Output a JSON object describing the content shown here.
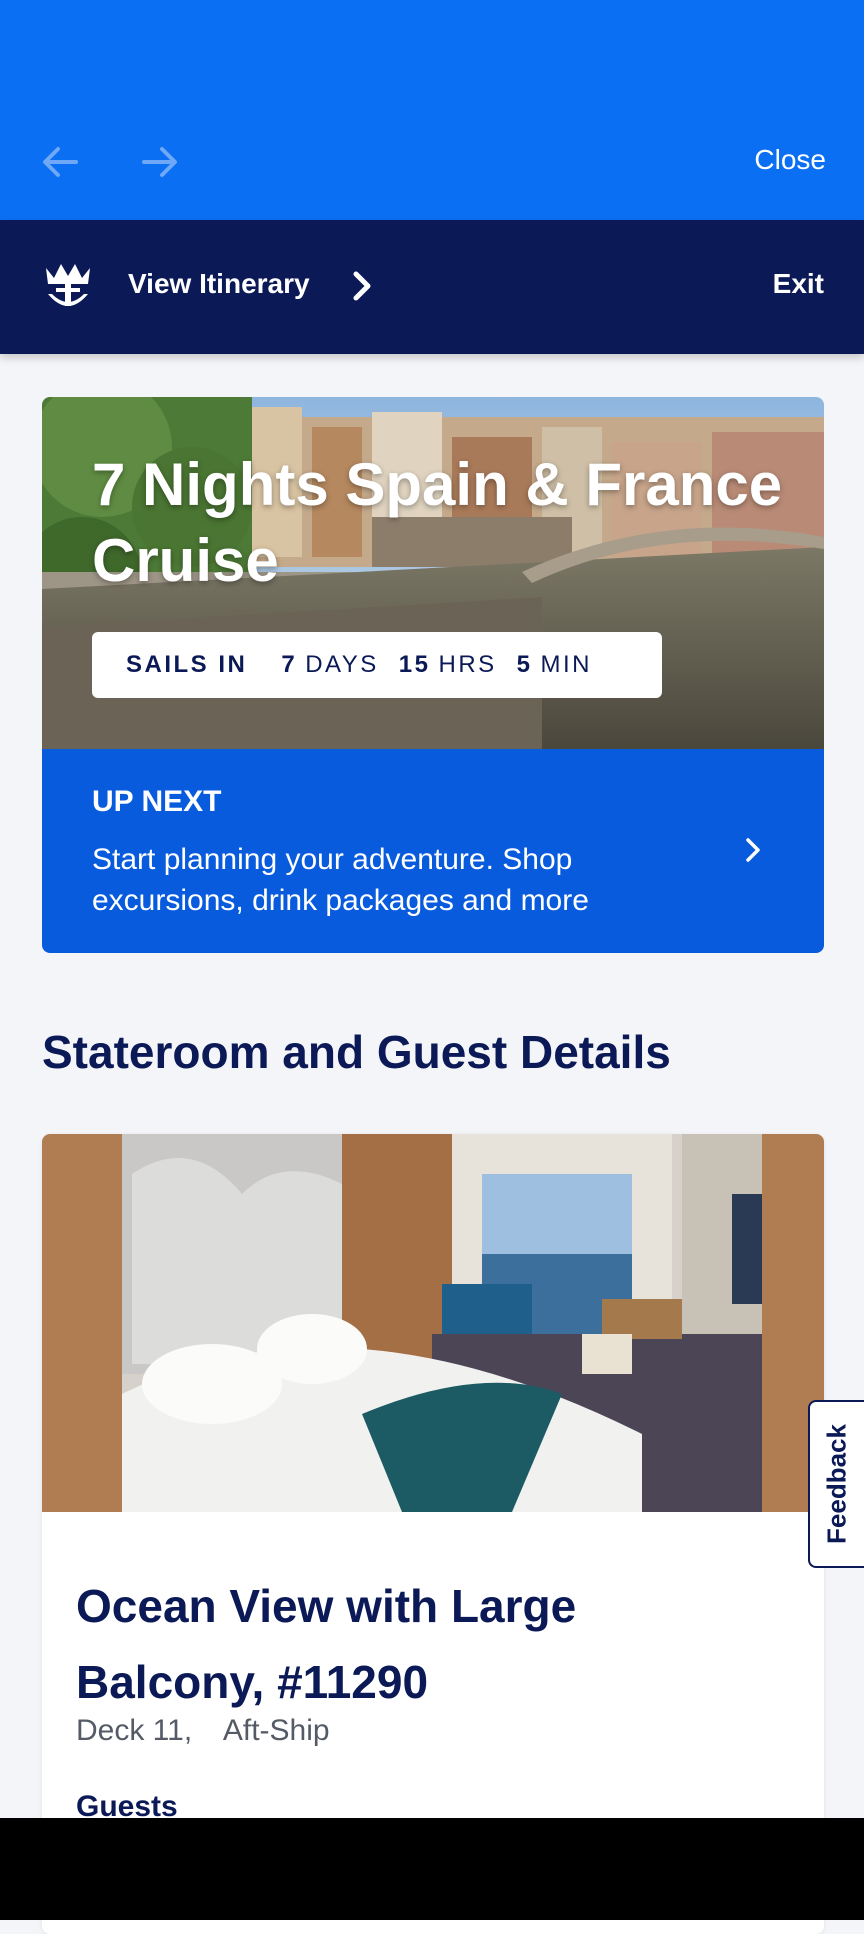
{
  "browser": {
    "close_label": "Close",
    "icons": {
      "back": "arrow-left-icon",
      "forward": "arrow-right-icon"
    }
  },
  "header": {
    "logo_icon": "crown-anchor-icon",
    "itinerary_label": "View Itinerary",
    "exit_label": "Exit"
  },
  "hero": {
    "title": "7 Nights Spain & France Cruise",
    "countdown": {
      "label": "SAILS IN",
      "days": "7",
      "days_unit": "DAYS",
      "hours": "15",
      "hours_unit": "HRS",
      "minutes": "5",
      "minutes_unit": "MIN"
    }
  },
  "up_next": {
    "label": "UP NEXT",
    "text": "Start planning your adventure. Shop excursions, drink packages and more"
  },
  "stateroom": {
    "section_title": "Stateroom and Guest Details",
    "room_title": "Ocean View with Large Balcony, #11290",
    "deck": "Deck 11,",
    "location": "Aft-Ship",
    "guests_label": "Guests"
  },
  "feedback_label": "Feedback",
  "colors": {
    "browser_blue": "#0a6ff2",
    "navy": "#0b1a56",
    "up_next_blue": "#075bdc",
    "page_bg": "#f4f5f8"
  }
}
